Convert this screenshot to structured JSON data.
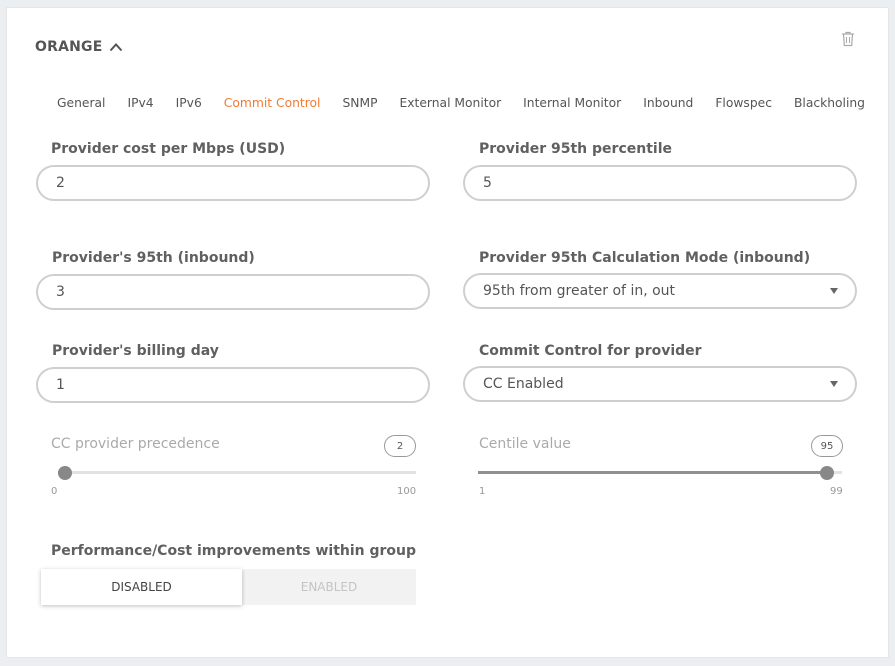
{
  "header": {
    "title": "ORANGE"
  },
  "tabs": [
    {
      "label": "General"
    },
    {
      "label": "IPv4"
    },
    {
      "label": "IPv6"
    },
    {
      "label": "Commit Control",
      "active": true
    },
    {
      "label": "SNMP"
    },
    {
      "label": "External Monitor"
    },
    {
      "label": "Internal Monitor"
    },
    {
      "label": "Inbound"
    },
    {
      "label": "Flowspec"
    },
    {
      "label": "Blackholing"
    }
  ],
  "fields": {
    "cost_per_mbps": {
      "label": "Provider cost per Mbps (USD)",
      "value": "2"
    },
    "percentile_95": {
      "label": "Provider 95th percentile",
      "value": "5"
    },
    "inbound_95": {
      "label": "Provider's 95th (inbound)",
      "value": "3"
    },
    "calc_mode_inbound": {
      "label": "Provider 95th Calculation Mode (inbound)",
      "value": "95th from greater of in, out"
    },
    "billing_day": {
      "label": "Provider's billing day",
      "value": "1"
    },
    "commit_control": {
      "label": "Commit Control for provider",
      "value": "CC Enabled"
    }
  },
  "sliders": {
    "precedence": {
      "label": "CC provider precedence",
      "value": 2,
      "value_text": "2",
      "min": 0,
      "max": 100,
      "min_text": "0",
      "max_text": "100"
    },
    "centile": {
      "label": "Centile value",
      "value": 95,
      "value_text": "95",
      "min": 1,
      "max": 99,
      "min_text": "1",
      "max_text": "99"
    }
  },
  "toggle": {
    "label": "Performance/Cost improvements within group",
    "disabled_label": "DISABLED",
    "enabled_label": "ENABLED",
    "selected": "disabled"
  },
  "colors": {
    "accent": "#f07c34"
  }
}
